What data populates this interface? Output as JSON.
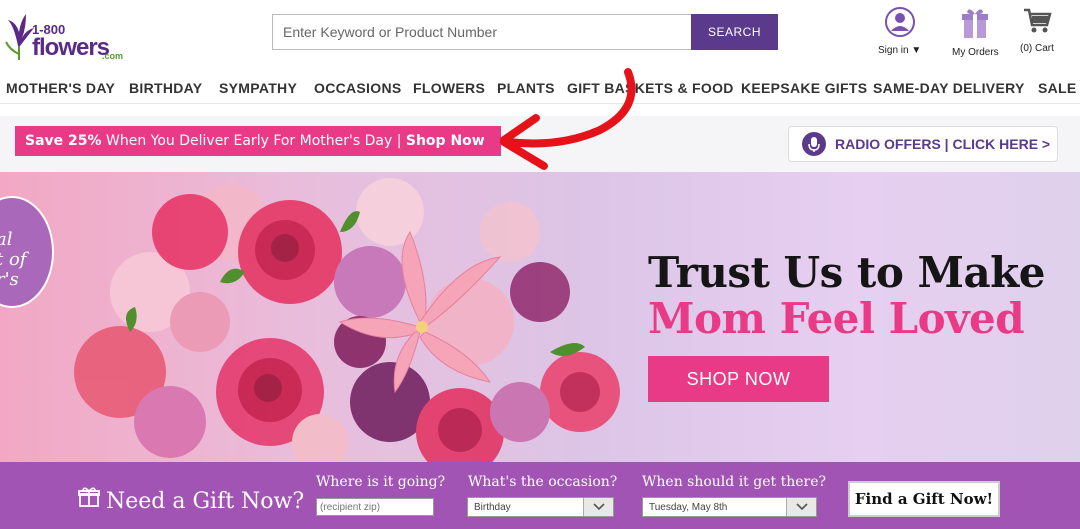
{
  "logo": {
    "number": "1-800",
    "word": "flowers",
    "suffix": ".com"
  },
  "search": {
    "placeholder": "Enter Keyword or Product Number",
    "button_label": "SEARCH"
  },
  "header_actions": {
    "signin_label": "Sign in",
    "orders_label": "My Orders",
    "cart_count": "(0)",
    "cart_label": "Cart"
  },
  "nav": {
    "items": [
      "MOTHER'S DAY",
      "BIRTHDAY",
      "SYMPATHY",
      "OCCASIONS",
      "FLOWERS",
      "PLANTS",
      "GIFT BASKETS & FOOD",
      "KEEPSAKE GIFTS",
      "SAME-DAY DELIVERY",
      "SALE"
    ]
  },
  "promo": {
    "save": "Save 25%",
    "text": " When You Deliver Early For Mother's Day | ",
    "shop": "Shop Now"
  },
  "radio": {
    "label": "RADIO OFFERS | CLICK HERE >"
  },
  "hero": {
    "circle_text_1": "al",
    "circle_text_2": "t of",
    "circle_text_3": "r's",
    "title_line1": "Trust Us to Make",
    "title_line2": "Mom Feel Loved",
    "button_label": "SHOP NOW"
  },
  "gift_finder": {
    "title": "Need a Gift Now?",
    "where_label": "Where is it going?",
    "where_placeholder": "(recipient zip)",
    "occasion_label": "What's the occasion?",
    "occasion_value": "Birthday",
    "when_label": "When should it get there?",
    "when_value": "Tuesday, May 8th",
    "find_label": "Find a Gift Now!"
  },
  "colors": {
    "brand_purple": "#5b3a8c",
    "accent_pink": "#e83a87",
    "gift_bar": "#a254b4",
    "arrow_red": "#e5121a"
  }
}
